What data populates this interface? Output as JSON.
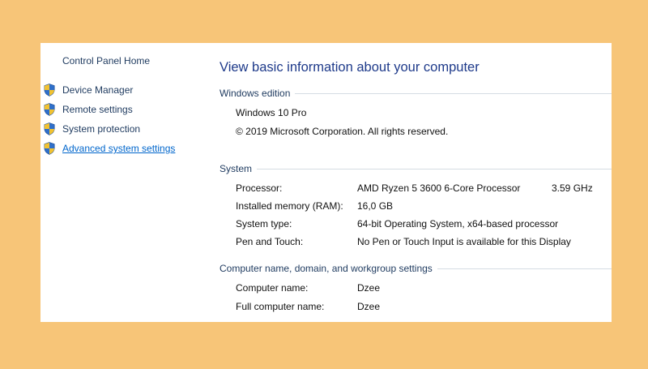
{
  "sidebar": {
    "home": "Control Panel Home",
    "items": [
      {
        "label": "Device Manager",
        "icon": "uac-shield-icon"
      },
      {
        "label": "Remote settings",
        "icon": "uac-shield-icon"
      },
      {
        "label": "System protection",
        "icon": "uac-shield-icon"
      },
      {
        "label": "Advanced system settings",
        "icon": "uac-shield-icon"
      }
    ]
  },
  "main": {
    "title": "View basic information about your computer",
    "edition": {
      "header": "Windows edition",
      "name": "Windows 10 Pro",
      "copyright": "© 2019 Microsoft Corporation. All rights reserved."
    },
    "system": {
      "header": "System",
      "rows": [
        {
          "label": "Processor:",
          "value": "AMD Ryzen 5 3600 6-Core Processor",
          "extra": "3.59 GHz"
        },
        {
          "label": "Installed memory (RAM):",
          "value": "16,0 GB"
        },
        {
          "label": "System type:",
          "value": "64-bit Operating System, x64-based processor"
        },
        {
          "label": "Pen and Touch:",
          "value": "No Pen or Touch Input is available for this Display"
        }
      ]
    },
    "computer": {
      "header": "Computer name, domain, and workgroup settings",
      "rows": [
        {
          "label": "Computer name:",
          "value": "Dzee"
        },
        {
          "label": "Full computer name:",
          "value": "Dzee"
        }
      ]
    }
  },
  "colors": {
    "background": "#F7C578",
    "link": "#0066CC",
    "title": "#1E3A8A",
    "shield_blue": "#2F6FC9",
    "shield_yellow": "#F2C230"
  }
}
